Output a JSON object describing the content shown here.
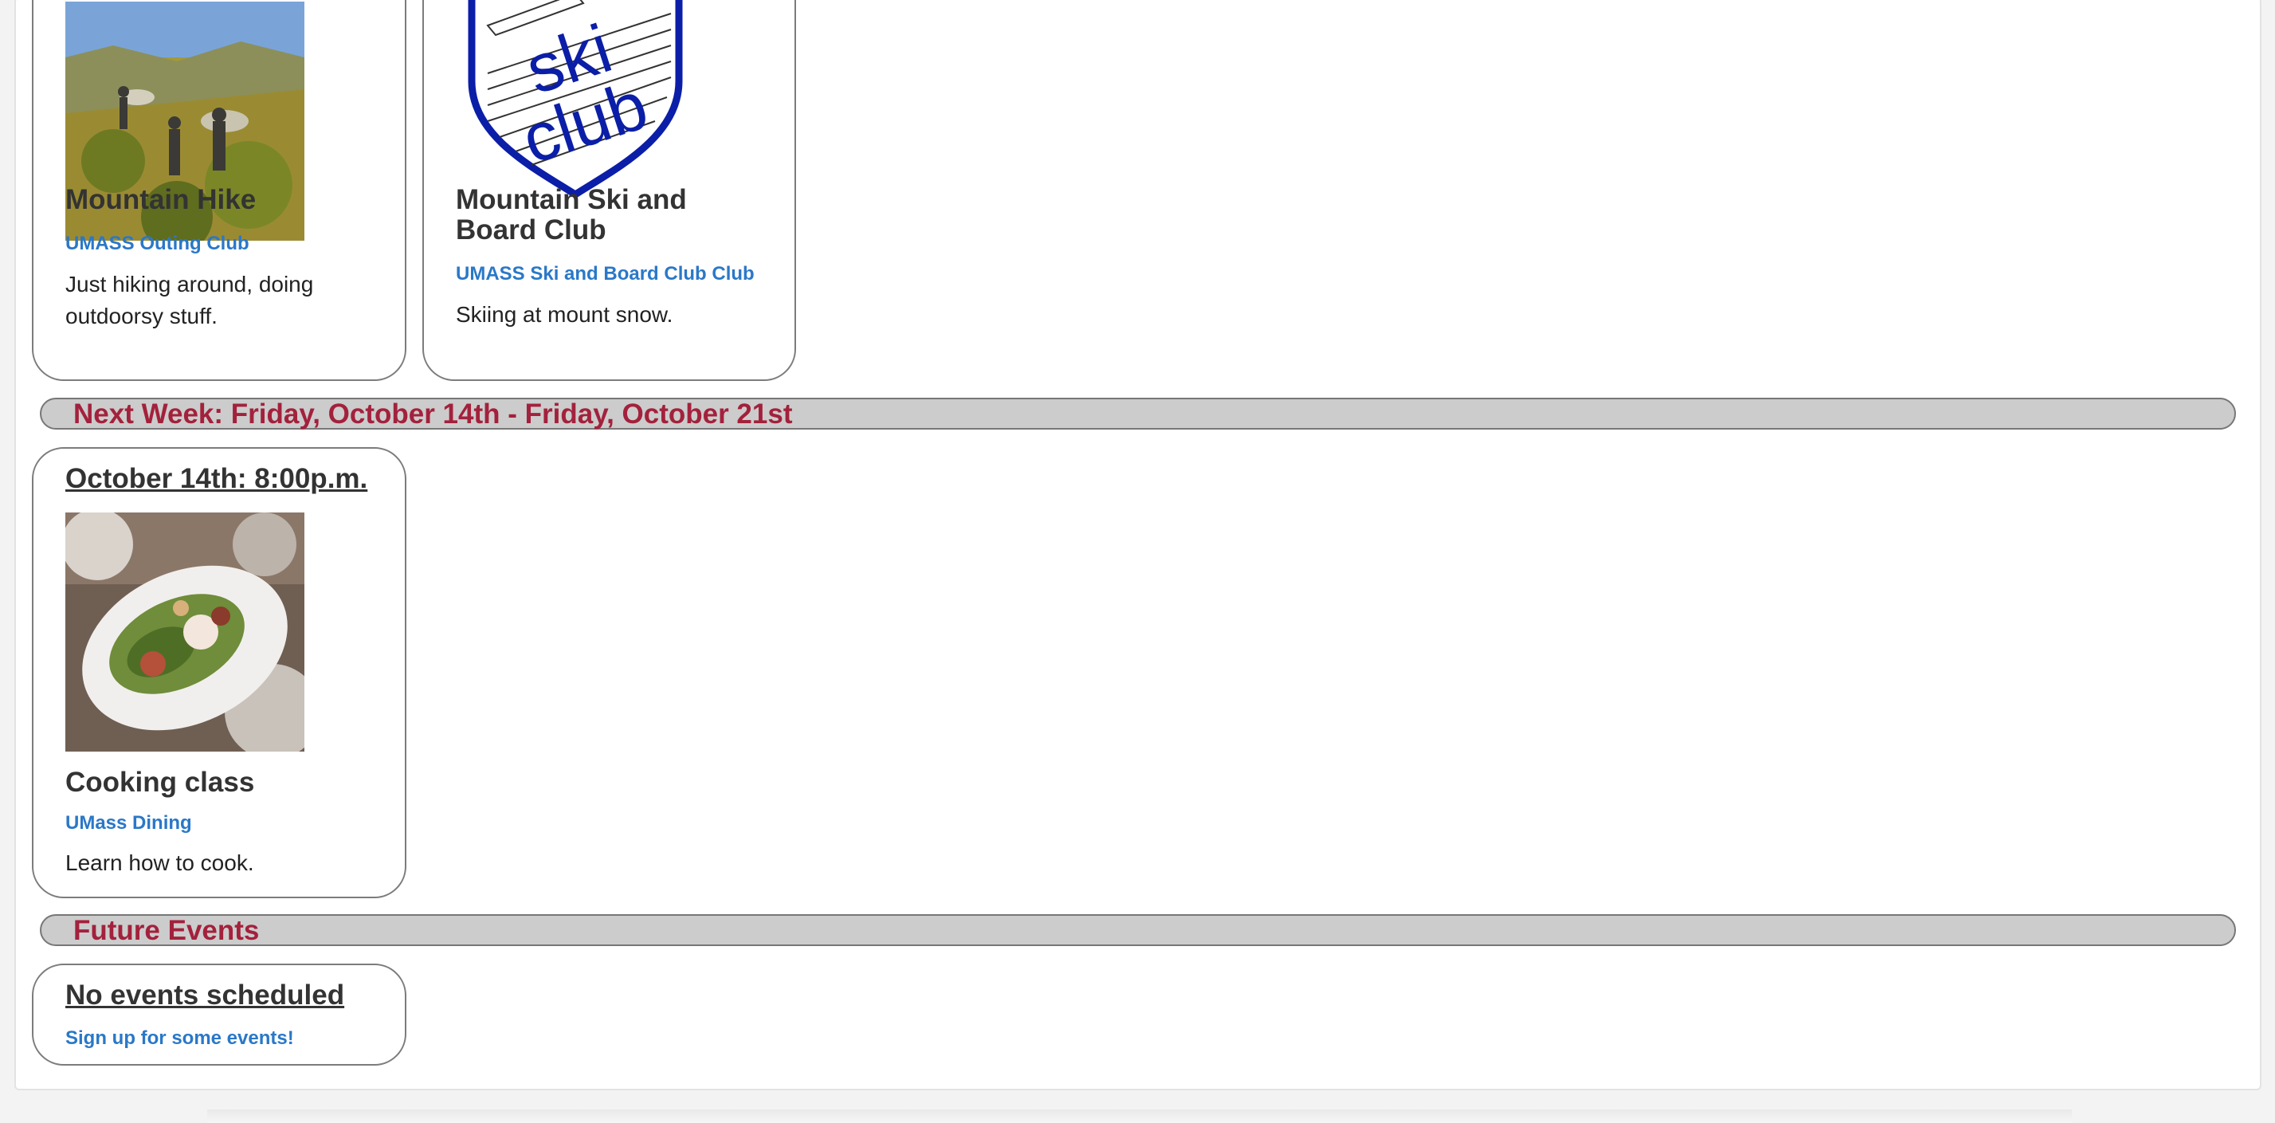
{
  "events_top": [
    {
      "title": "Mountain Hike",
      "organizer": "UMASS Outing Club",
      "description": "Just hiking around, doing outdoorsy stuff."
    },
    {
      "title": "Mountain Ski and Board Club",
      "organizer": "UMASS Ski and Board Club Club",
      "description": "Skiing at mount snow.",
      "logo_text_1": "ski",
      "logo_text_2": "club"
    }
  ],
  "next_week": {
    "heading": "Next Week: Friday, October 14th - Friday, October 21st",
    "event": {
      "when": "October 14th: 8:00p.m.",
      "title": "Cooking class",
      "organizer": "UMass Dining",
      "description": "Learn how to cook."
    }
  },
  "future": {
    "heading": "Future Events",
    "empty_title": "No events scheduled",
    "signup_link": "Sign up for some events!"
  },
  "colors": {
    "section_text": "#a3213c",
    "link": "#2a78c8",
    "section_bg": "#cccccc"
  }
}
